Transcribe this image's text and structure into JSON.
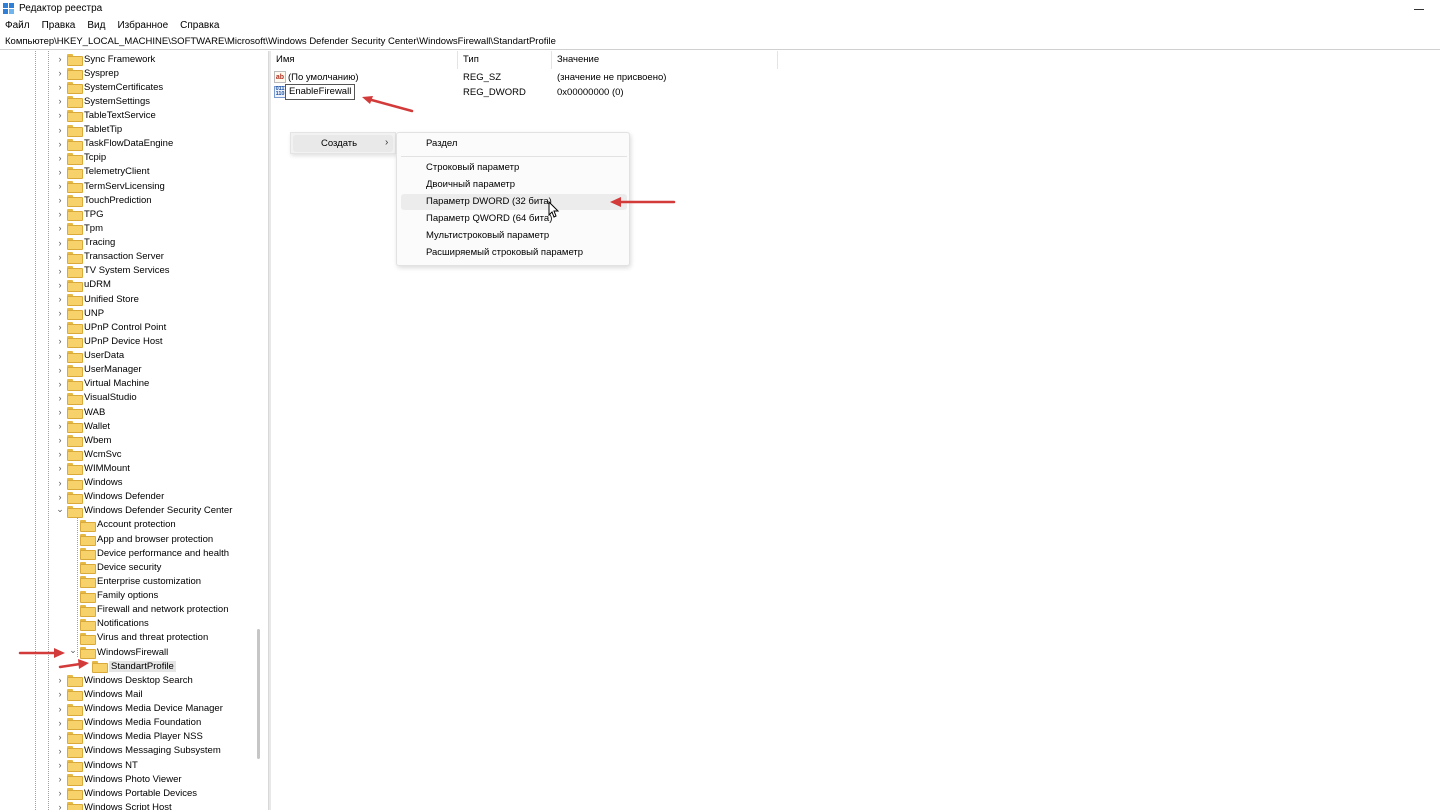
{
  "window": {
    "title": "Редактор реестра"
  },
  "menu": [
    "Файл",
    "Правка",
    "Вид",
    "Избранное",
    "Справка"
  ],
  "address": "Компьютер\\HKEY_LOCAL_MACHINE\\SOFTWARE\\Microsoft\\Windows Defender Security Center\\WindowsFirewall\\StandartProfile",
  "tree": {
    "items": [
      {
        "label": "Sync Framework",
        "depth": 0,
        "expander": "collapsed"
      },
      {
        "label": "Sysprep",
        "depth": 0,
        "expander": "collapsed"
      },
      {
        "label": "SystemCertificates",
        "depth": 0,
        "expander": "collapsed"
      },
      {
        "label": "SystemSettings",
        "depth": 0,
        "expander": "collapsed"
      },
      {
        "label": "TableTextService",
        "depth": 0,
        "expander": "collapsed"
      },
      {
        "label": "TabletTip",
        "depth": 0,
        "expander": "collapsed"
      },
      {
        "label": "TaskFlowDataEngine",
        "depth": 0,
        "expander": "collapsed"
      },
      {
        "label": "Tcpip",
        "depth": 0,
        "expander": "collapsed"
      },
      {
        "label": "TelemetryClient",
        "depth": 0,
        "expander": "collapsed"
      },
      {
        "label": "TermServLicensing",
        "depth": 0,
        "expander": "collapsed"
      },
      {
        "label": "TouchPrediction",
        "depth": 0,
        "expander": "collapsed"
      },
      {
        "label": "TPG",
        "depth": 0,
        "expander": "collapsed"
      },
      {
        "label": "Tpm",
        "depth": 0,
        "expander": "collapsed"
      },
      {
        "label": "Tracing",
        "depth": 0,
        "expander": "collapsed"
      },
      {
        "label": "Transaction Server",
        "depth": 0,
        "expander": "collapsed"
      },
      {
        "label": "TV System Services",
        "depth": 0,
        "expander": "collapsed"
      },
      {
        "label": "uDRM",
        "depth": 0,
        "expander": "collapsed"
      },
      {
        "label": "Unified Store",
        "depth": 0,
        "expander": "collapsed"
      },
      {
        "label": "UNP",
        "depth": 0,
        "expander": "collapsed"
      },
      {
        "label": "UPnP Control Point",
        "depth": 0,
        "expander": "collapsed"
      },
      {
        "label": "UPnP Device Host",
        "depth": 0,
        "expander": "collapsed"
      },
      {
        "label": "UserData",
        "depth": 0,
        "expander": "collapsed"
      },
      {
        "label": "UserManager",
        "depth": 0,
        "expander": "collapsed"
      },
      {
        "label": "Virtual Machine",
        "depth": 0,
        "expander": "collapsed"
      },
      {
        "label": "VisualStudio",
        "depth": 0,
        "expander": "collapsed"
      },
      {
        "label": "WAB",
        "depth": 0,
        "expander": "collapsed"
      },
      {
        "label": "Wallet",
        "depth": 0,
        "expander": "collapsed"
      },
      {
        "label": "Wbem",
        "depth": 0,
        "expander": "collapsed"
      },
      {
        "label": "WcmSvc",
        "depth": 0,
        "expander": "collapsed"
      },
      {
        "label": "WIMMount",
        "depth": 0,
        "expander": "collapsed"
      },
      {
        "label": "Windows",
        "depth": 0,
        "expander": "collapsed"
      },
      {
        "label": "Windows Defender",
        "depth": 0,
        "expander": "collapsed"
      },
      {
        "label": "Windows Defender Security Center",
        "depth": 0,
        "expander": "expanded"
      },
      {
        "label": "Account protection",
        "depth": 1,
        "expander": "none"
      },
      {
        "label": "App and browser protection",
        "depth": 1,
        "expander": "none"
      },
      {
        "label": "Device performance and health",
        "depth": 1,
        "expander": "none"
      },
      {
        "label": "Device security",
        "depth": 1,
        "expander": "none"
      },
      {
        "label": "Enterprise customization",
        "depth": 1,
        "expander": "none"
      },
      {
        "label": "Family options",
        "depth": 1,
        "expander": "none"
      },
      {
        "label": "Firewall and network protection",
        "depth": 1,
        "expander": "none"
      },
      {
        "label": "Notifications",
        "depth": 1,
        "expander": "none"
      },
      {
        "label": "Virus and threat protection",
        "depth": 1,
        "expander": "none"
      },
      {
        "label": "WindowsFirewall",
        "depth": 1,
        "expander": "expanded"
      },
      {
        "label": "StandartProfile",
        "depth": 2,
        "expander": "none",
        "selected": true
      },
      {
        "label": "Windows Desktop Search",
        "depth": 0,
        "expander": "collapsed"
      },
      {
        "label": "Windows Mail",
        "depth": 0,
        "expander": "collapsed"
      },
      {
        "label": "Windows Media Device Manager",
        "depth": 0,
        "expander": "collapsed"
      },
      {
        "label": "Windows Media Foundation",
        "depth": 0,
        "expander": "collapsed"
      },
      {
        "label": "Windows Media Player NSS",
        "depth": 0,
        "expander": "collapsed"
      },
      {
        "label": "Windows Messaging Subsystem",
        "depth": 0,
        "expander": "collapsed"
      },
      {
        "label": "Windows NT",
        "depth": 0,
        "expander": "collapsed"
      },
      {
        "label": "Windows Photo Viewer",
        "depth": 0,
        "expander": "collapsed"
      },
      {
        "label": "Windows Portable Devices",
        "depth": 0,
        "expander": "collapsed"
      },
      {
        "label": "Windows Script Host",
        "depth": 0,
        "expander": "collapsed"
      }
    ]
  },
  "list": {
    "columns": [
      "Имя",
      "Тип",
      "Значение"
    ],
    "rows": [
      {
        "name": "(По умолчанию)",
        "type": "REG_SZ",
        "value": "(значение не присвоено)",
        "icon": "string-value-icon"
      },
      {
        "name": "EnableFirewall",
        "type": "REG_DWORD",
        "value": "0x00000000 (0)",
        "icon": "dword-value-icon",
        "renaming": true
      }
    ]
  },
  "icons": {
    "string_value_glyph": "ab",
    "dword_value_glyph": "011 110"
  },
  "context_menu": {
    "create_label": "Создать",
    "arrow": "›"
  },
  "submenu": {
    "items": [
      {
        "label": "Раздел"
      },
      {
        "label": "Строковый параметр"
      },
      {
        "label": "Двоичный параметр"
      },
      {
        "label": "Параметр DWORD (32 бита)",
        "hover": true
      },
      {
        "label": "Параметр QWORD (64 бита)"
      },
      {
        "label": "Мультистроковый параметр"
      },
      {
        "label": "Расширяемый строковый параметр"
      }
    ]
  },
  "colors": {
    "annotation_arrow": "#d33a3a",
    "folder": "#f7d26a"
  }
}
